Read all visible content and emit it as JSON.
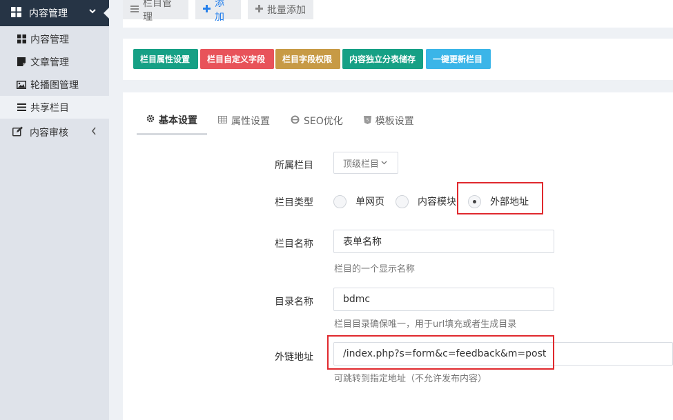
{
  "sidebar": {
    "header": {
      "label": "内容管理"
    },
    "items": [
      {
        "label": "内容管理",
        "icon": "grid-icon"
      },
      {
        "label": "文章管理",
        "icon": "note-icon"
      },
      {
        "label": "轮播图管理",
        "icon": "image-icon"
      },
      {
        "label": "共享栏目",
        "icon": "list-icon"
      }
    ],
    "group": {
      "label": "内容审核"
    }
  },
  "toolbar": {
    "manage_label": "栏目管理",
    "add_label": "添加",
    "batch_add_label": "批量添加"
  },
  "actions": {
    "buttons": [
      {
        "label": "栏目属性设置",
        "color": "#16a085"
      },
      {
        "label": "栏目自定义字段",
        "color": "#e8535a"
      },
      {
        "label": "栏目字段权限",
        "color": "#c79a45"
      },
      {
        "label": "内容独立分表储存",
        "color": "#16a085"
      },
      {
        "label": "一键更新栏目",
        "color": "#3bb5e8"
      }
    ]
  },
  "tabs": [
    {
      "label": "基本设置",
      "active": true
    },
    {
      "label": "属性设置"
    },
    {
      "label": "SEO优化"
    },
    {
      "label": "模板设置"
    }
  ],
  "form": {
    "parent": {
      "label": "所属栏目",
      "value": "顶级栏目"
    },
    "type": {
      "label": "栏目类型",
      "options": [
        "单网页",
        "内容模块",
        "外部地址"
      ],
      "selected": "外部地址"
    },
    "name": {
      "label": "栏目名称",
      "value": "表单名称",
      "hint": "栏目的一个显示名称"
    },
    "dir": {
      "label": "目录名称",
      "value": "bdmc",
      "hint": "栏目目录确保唯一，用于url填充或者生成目录"
    },
    "link": {
      "label": "外链地址",
      "value": "/index.php?s=form&c=feedback&m=post",
      "hint": "可跳转到指定地址（不允许发布内容）"
    }
  },
  "colors": {
    "sidebar_header": "#263445",
    "highlight": "#e0282d"
  }
}
